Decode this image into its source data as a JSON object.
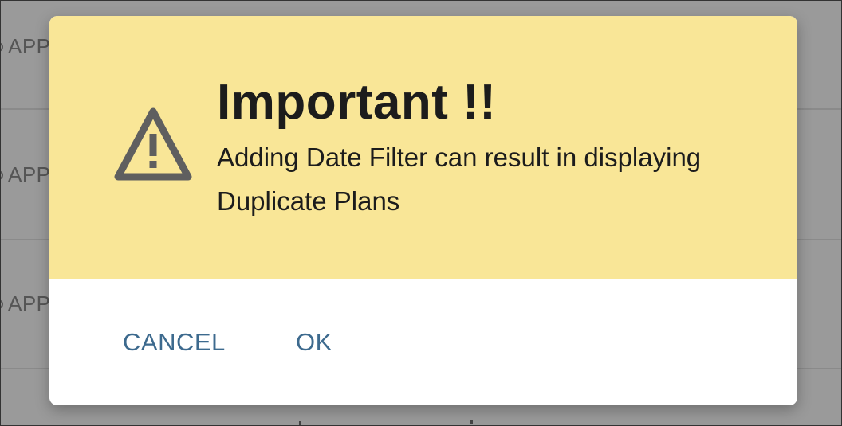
{
  "background": {
    "rows": [
      {
        "label": "APP"
      },
      {
        "label": "APP"
      },
      {
        "label": "APP"
      }
    ]
  },
  "dialog": {
    "icon": "warning-triangle-icon",
    "title": "Important !!",
    "message": "Adding Date Filter can result in displaying Duplicate Plans",
    "cancel_label": "CANCEL",
    "ok_label": "OK",
    "header_color": "#f9e697",
    "button_color": "#3d6a8e"
  }
}
